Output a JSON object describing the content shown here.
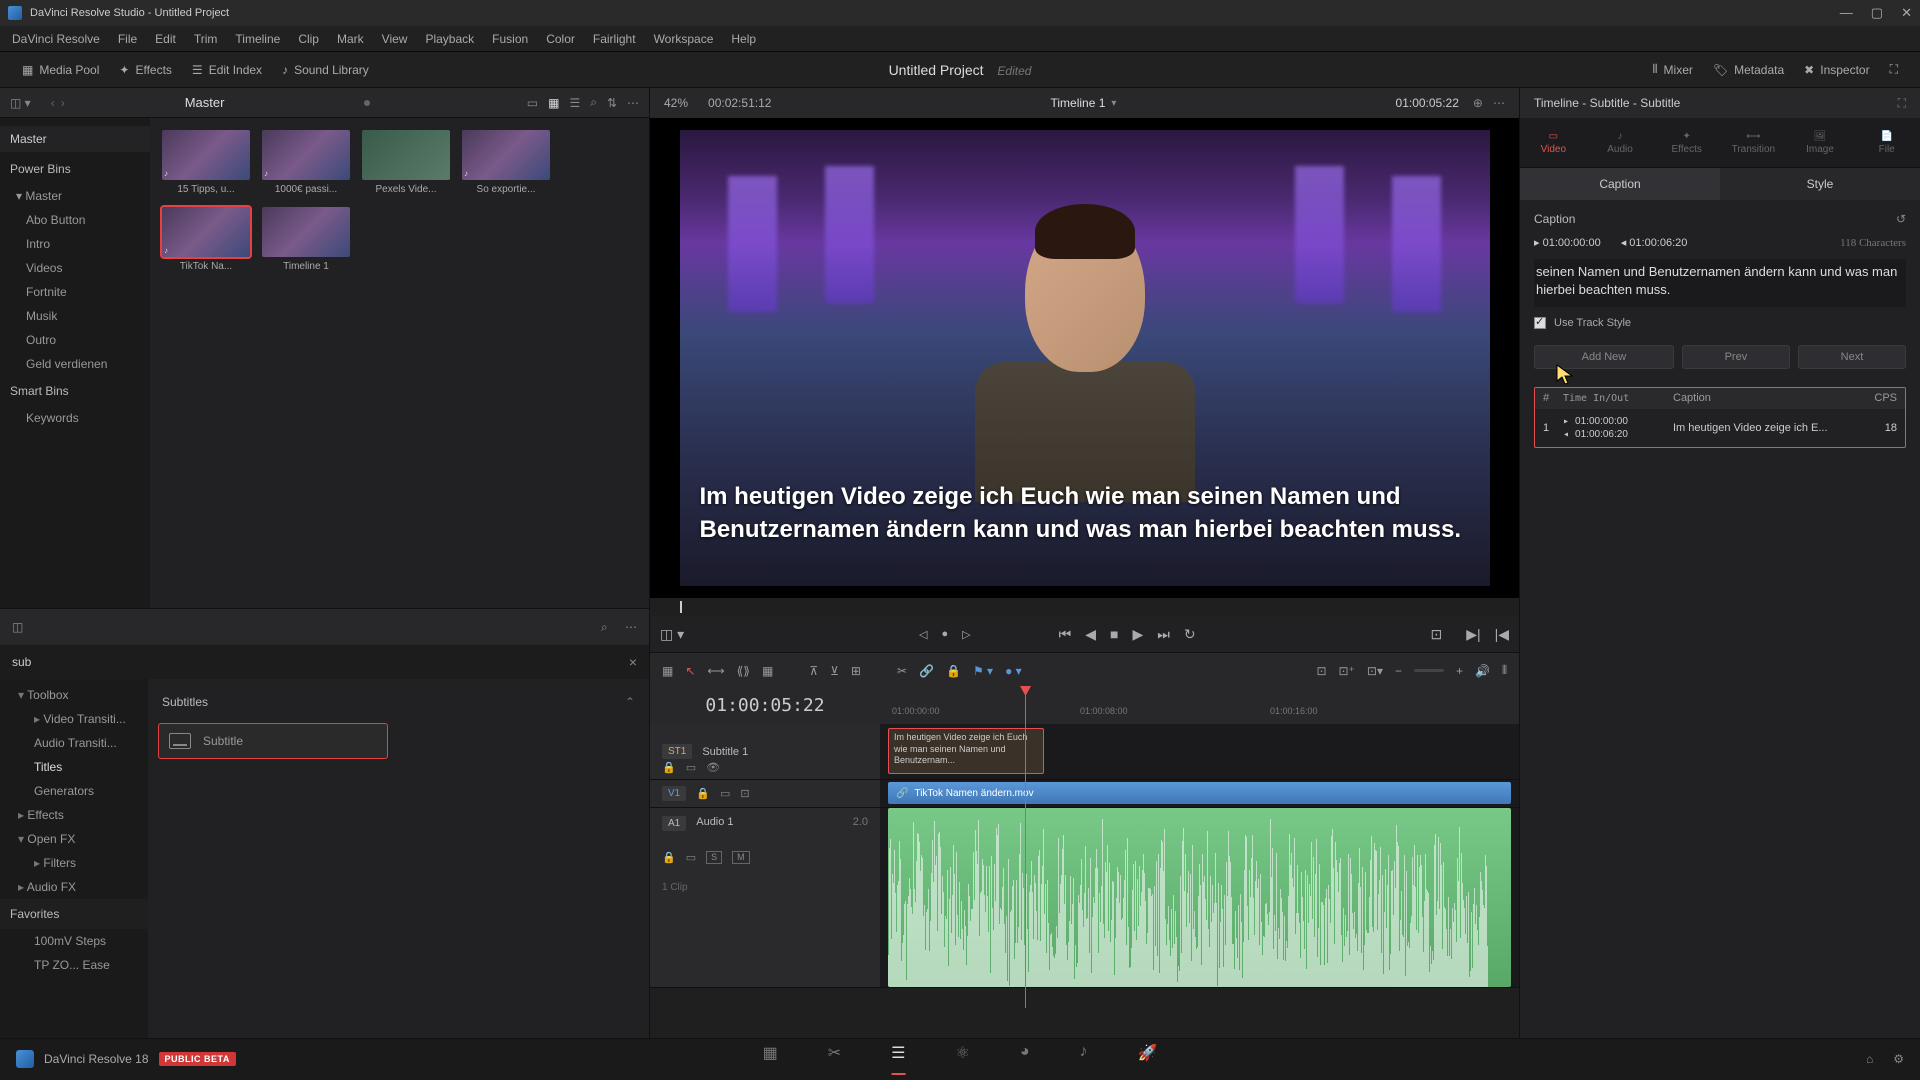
{
  "window": {
    "title": "DaVinci Resolve Studio - Untitled Project"
  },
  "menu": [
    "DaVinci Resolve",
    "File",
    "Edit",
    "Trim",
    "Timeline",
    "Clip",
    "Mark",
    "View",
    "Playback",
    "Fusion",
    "Color",
    "Fairlight",
    "Workspace",
    "Help"
  ],
  "toolbar": {
    "media_pool": "Media Pool",
    "effects": "Effects",
    "edit_index": "Edit Index",
    "sound_library": "Sound Library",
    "mixer": "Mixer",
    "metadata": "Metadata",
    "inspector": "Inspector"
  },
  "project": {
    "title": "Untitled Project",
    "status": "Edited"
  },
  "media": {
    "breadcrumb": "Master",
    "bins_header": "Master",
    "power_bins": "Power Bins",
    "power_master": "Master",
    "items": [
      "Abo Button",
      "Intro",
      "Videos",
      "Fortnite",
      "Musik",
      "Outro",
      "Geld verdienen"
    ],
    "smart_bins": "Smart Bins",
    "smart_items": [
      "Keywords"
    ],
    "thumbs": [
      {
        "label": "15 Tipps, u..."
      },
      {
        "label": "1000€ passi..."
      },
      {
        "label": "Pexels Vide..."
      },
      {
        "label": "So exportie..."
      },
      {
        "label": "TikTok Na...",
        "selected": true
      },
      {
        "label": "Timeline 1"
      }
    ]
  },
  "effects_panel": {
    "search_value": "sub",
    "tree": {
      "toolbox": "Toolbox",
      "video_trans": "Video Transiti...",
      "audio_trans": "Audio Transiti...",
      "titles": "Titles",
      "generators": "Generators",
      "effects": "Effects",
      "openfx": "Open FX",
      "filters": "Filters",
      "audiofx": "Audio FX",
      "favorites": "Favorites",
      "fav1": "100mV Steps",
      "fav2": "TP ZO... Ease"
    },
    "list_header": "Subtitles",
    "item": "Subtitle"
  },
  "viewer": {
    "percent": "42%",
    "tc_left": "00:02:51:12",
    "title": "Timeline 1",
    "tc_right": "01:00:05:22",
    "subtitle_text": "Im heutigen Video zeige ich Euch wie man seinen Namen und Benutzernamen ändern kann und was man hierbei beachten muss."
  },
  "timeline": {
    "current_tc": "01:00:05:22",
    "ticks": [
      "01:00:00:00",
      "01:00:08:00",
      "01:00:16:00"
    ],
    "tracks": {
      "subtitle": {
        "badge": "ST1",
        "name": "Subtitle 1",
        "clip_text": "Im heutigen Video zeige ich Euch wie man seinen Namen und Benutzernam..."
      },
      "video": {
        "badge": "V1",
        "clip_name": "TikTok Namen ändern.mov"
      },
      "audio": {
        "badge": "A1",
        "name": "Audio 1",
        "level": "2.0",
        "clips": "1 Clip"
      }
    }
  },
  "inspector": {
    "header": "Timeline - Subtitle - Subtitle",
    "tabs": [
      "Video",
      "Audio",
      "Effects",
      "Transition",
      "Image",
      "File"
    ],
    "subtabs": [
      "Caption",
      "Style"
    ],
    "caption_label": "Caption",
    "tc_in": "01:00:00:00",
    "tc_out": "01:00:06:20",
    "char_count": "118 Characters",
    "caption_text": "seinen Namen und Benutzernamen ändern kann und was man hierbei beachten muss.",
    "use_track_style": "Use Track Style",
    "add_new": "Add New",
    "prev": "Prev",
    "next": "Next",
    "table": {
      "headers": {
        "num": "#",
        "time": "Time In/Out",
        "caption": "Caption",
        "cps": "CPS"
      },
      "rows": [
        {
          "num": "1",
          "tin": "01:00:00:00",
          "tout": "01:00:06:20",
          "caption": "Im heutigen Video zeige ich E...",
          "cps": "18"
        }
      ]
    }
  },
  "statusbar": {
    "version": "DaVinci Resolve 18",
    "beta": "PUBLIC BETA"
  }
}
